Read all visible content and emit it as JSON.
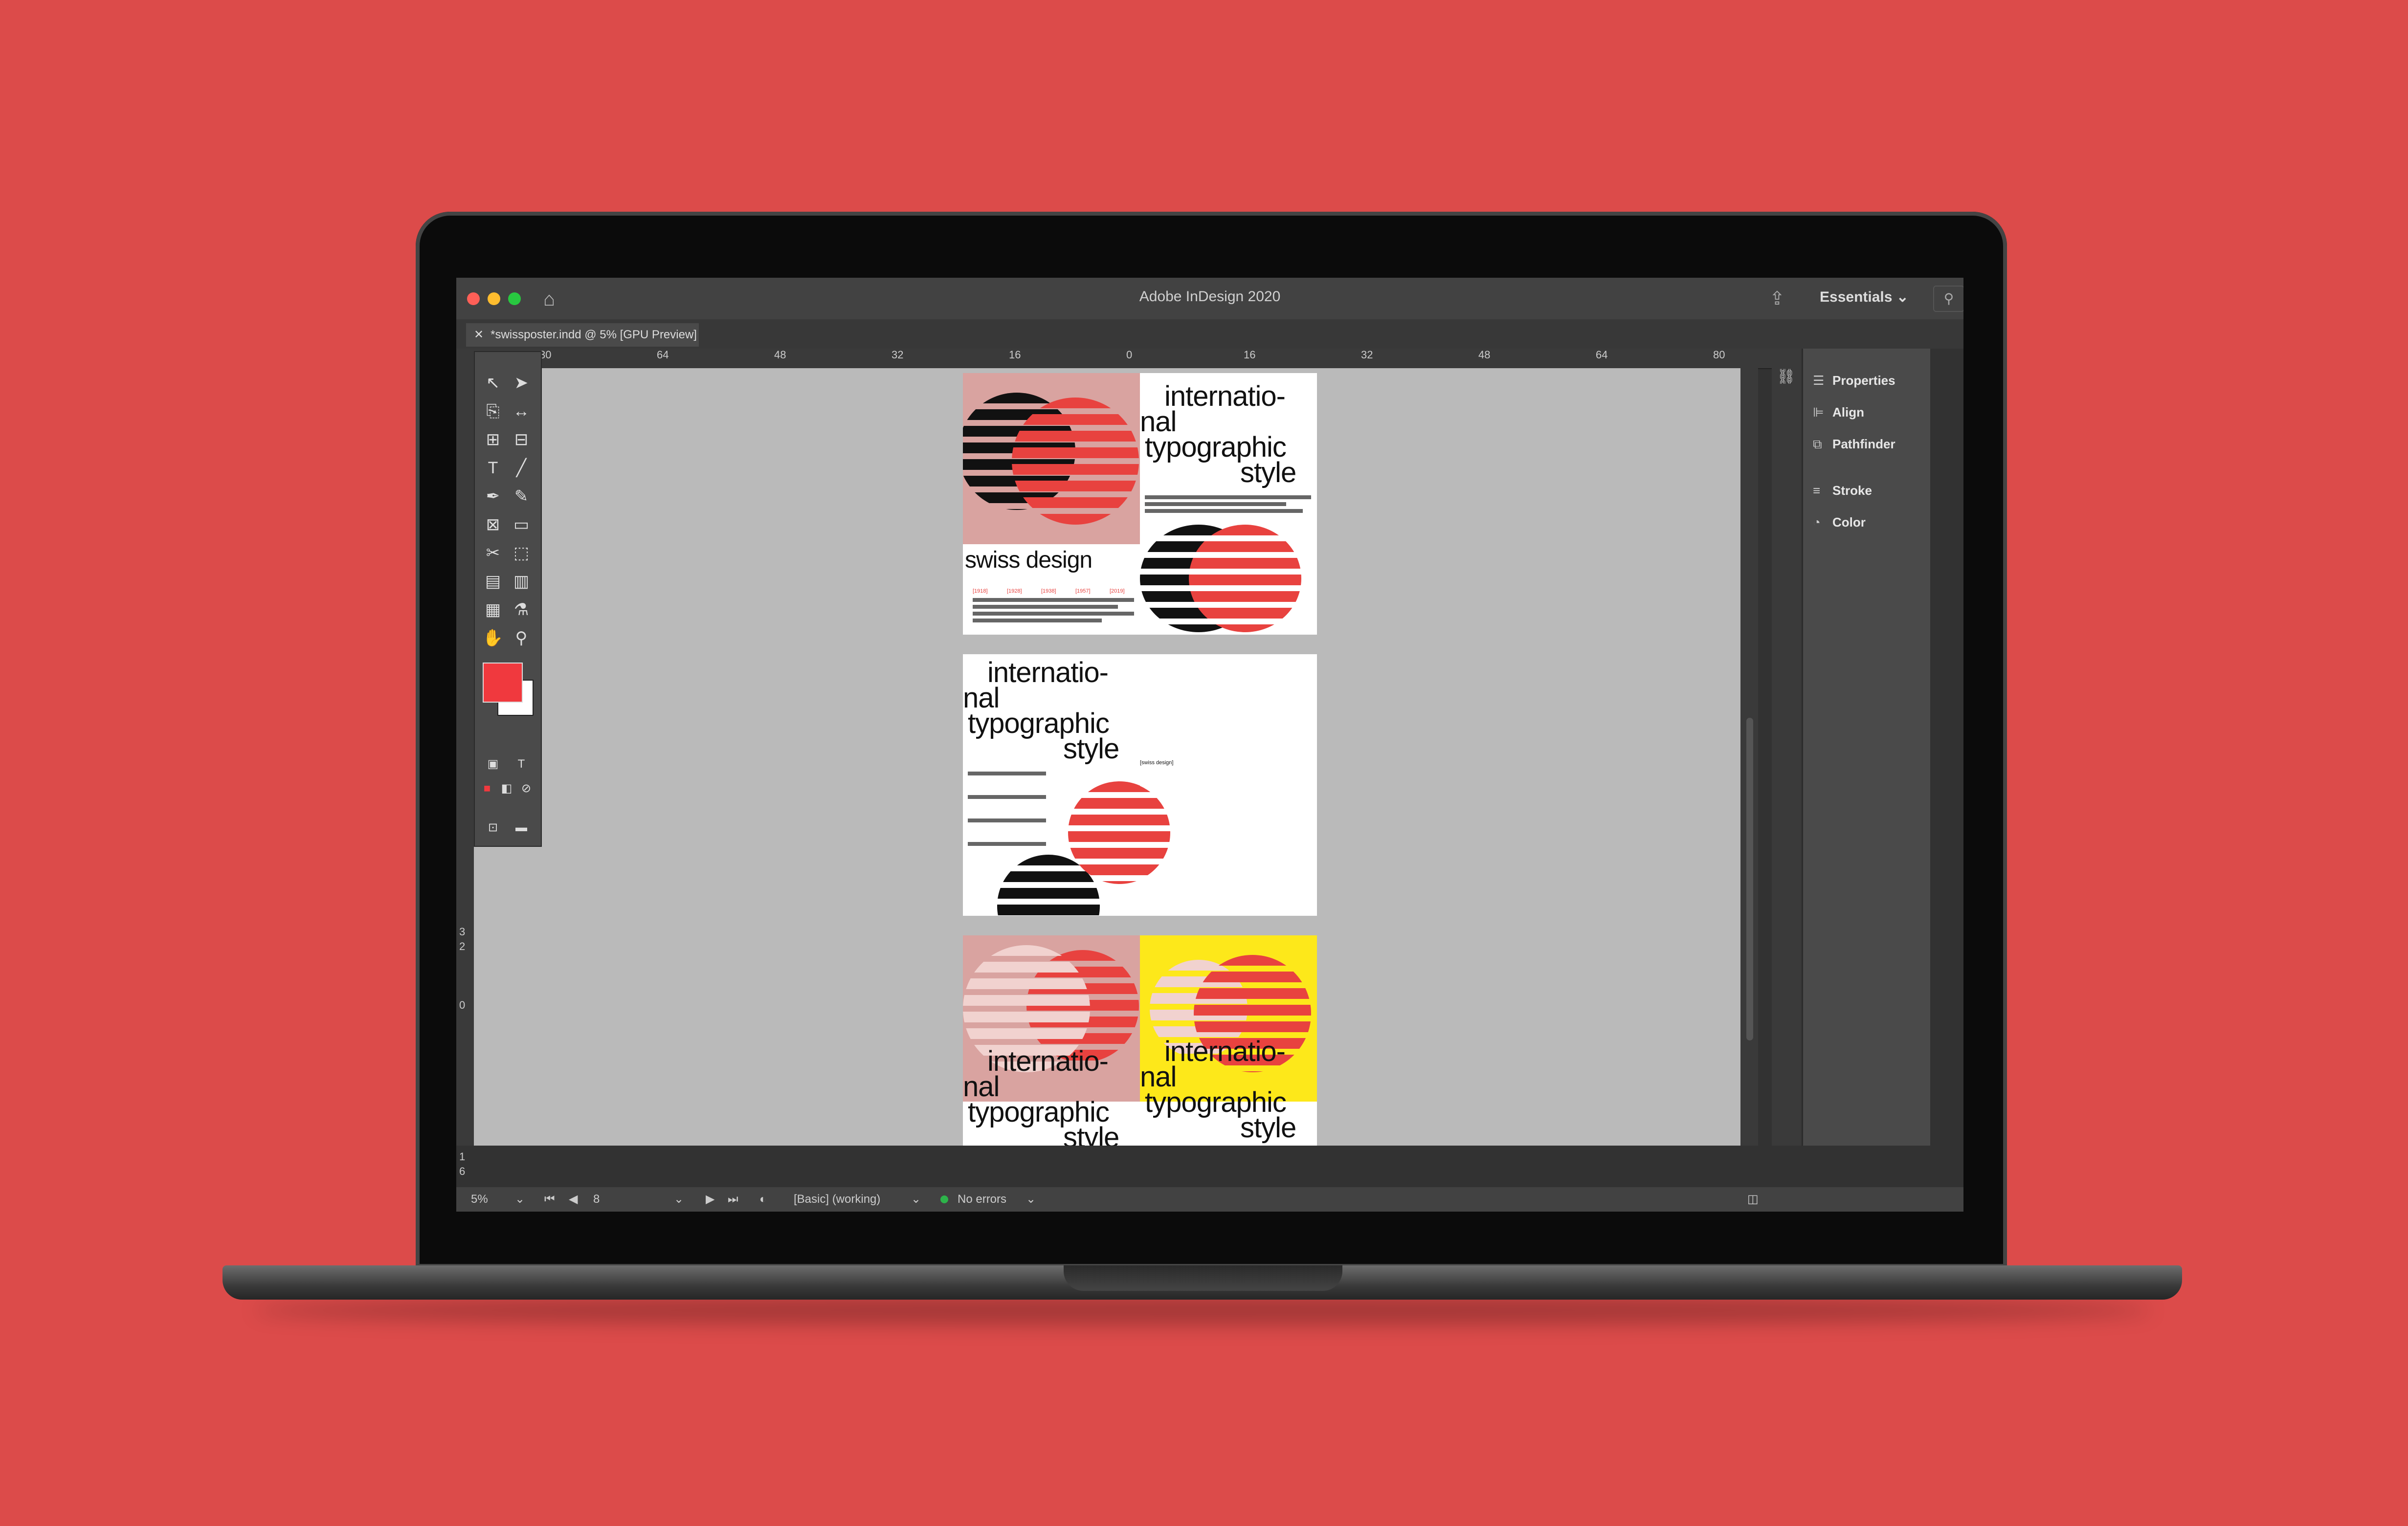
{
  "window": {
    "title": "Adobe InDesign 2020",
    "workspace": "Essentials",
    "document_tab": "*swissposter.indd @ 5% [GPU Preview]"
  },
  "ruler": {
    "ticks": [
      "80",
      "64",
      "48",
      "32",
      "16",
      "0",
      "16",
      "32",
      "48",
      "64",
      "80"
    ]
  },
  "vruler": {
    "ticks": [
      "3",
      "2",
      "0",
      "1",
      "6",
      "3"
    ]
  },
  "panels": {
    "items": [
      {
        "label": "Properties",
        "icon": "properties-icon"
      },
      {
        "label": "Align",
        "icon": "align-icon"
      },
      {
        "label": "Pathfinder",
        "icon": "pathfinder-icon"
      },
      {
        "label": "Stroke",
        "icon": "stroke-icon"
      },
      {
        "label": "Color",
        "icon": "color-icon"
      }
    ]
  },
  "status": {
    "zoom": "5%",
    "page": "8",
    "preflight_profile": "[Basic] (working)",
    "errors": "No errors"
  },
  "colors": {
    "fill": "#f0393e",
    "background": "#dc4b4a",
    "accent_yellow": "#fde81a"
  },
  "poster": {
    "swiss": "swiss design",
    "headline_1": "internatio-",
    "headline_2": "nal",
    "headline_3": "typographic",
    "headline_4": "style",
    "years": [
      "[1918]",
      "[1928]",
      "[1938]",
      "[1957]",
      "[2019]"
    ],
    "swiss_tag": "[swiss design]"
  }
}
